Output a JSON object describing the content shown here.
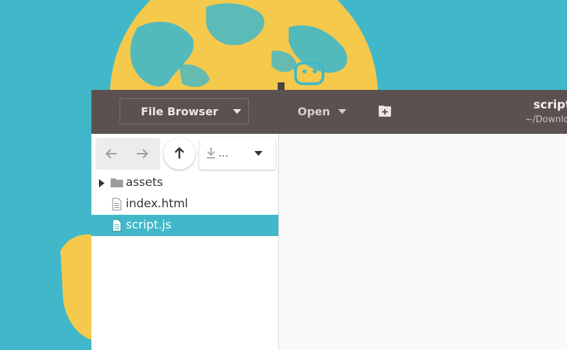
{
  "colors": {
    "desktop": "#41b8c9",
    "globe": "#f5c94c",
    "headerbar": "#5b5150",
    "selection": "#41b8c9"
  },
  "headerbar": {
    "picker_label": "File Browser",
    "open_label": "Open",
    "new_tab_icon": "new-document-icon",
    "title": "script.js",
    "subtitle": "~/Downloads"
  },
  "sidebar": {
    "nav": {
      "back_icon": "arrow-left-icon",
      "forward_icon": "arrow-right-icon",
      "up_icon": "arrow-up-icon",
      "location_icon": "download-icon",
      "location_label": "..."
    },
    "items": [
      {
        "name": "assets",
        "type": "folder",
        "expander": true,
        "selected": false
      },
      {
        "name": "index.html",
        "type": "file",
        "expander": false,
        "selected": false
      },
      {
        "name": "script.js",
        "type": "file",
        "expander": false,
        "selected": true
      }
    ]
  }
}
